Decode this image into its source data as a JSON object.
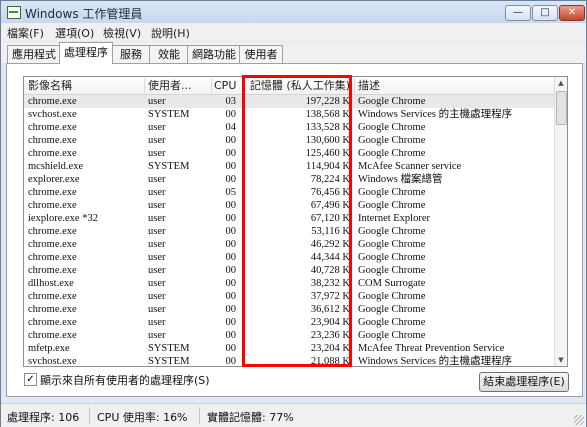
{
  "window": {
    "title": "Windows 工作管理員",
    "min": "—",
    "max": "□",
    "close": "✕"
  },
  "menu": [
    "檔案(F)",
    "選項(O)",
    "檢視(V)",
    "說明(H)"
  ],
  "tabs": [
    "應用程式",
    "處理程序",
    "服務",
    "效能",
    "網路功能",
    "使用者"
  ],
  "active_tab": "處理程序",
  "columns": {
    "name": "影像名稱",
    "user": "使用者...",
    "cpu": "CPU",
    "mem": "記憶體 (私人工作集)",
    "desc": "描述"
  },
  "rows": [
    {
      "name": "chrome.exe",
      "user": "user",
      "cpu": "03",
      "mem": "197,228 K",
      "desc": "Google Chrome"
    },
    {
      "name": "svchost.exe",
      "user": "SYSTEM",
      "cpu": "00",
      "mem": "138,568 K",
      "desc": "Windows Services 的主機處理程序"
    },
    {
      "name": "chrome.exe",
      "user": "user",
      "cpu": "04",
      "mem": "133,528 K",
      "desc": "Google Chrome"
    },
    {
      "name": "chrome.exe",
      "user": "user",
      "cpu": "00",
      "mem": "130,600 K",
      "desc": "Google Chrome"
    },
    {
      "name": "chrome.exe",
      "user": "user",
      "cpu": "00",
      "mem": "125,460 K",
      "desc": "Google Chrome"
    },
    {
      "name": "mcshield.exe",
      "user": "SYSTEM",
      "cpu": "00",
      "mem": "114,904 K",
      "desc": "McAfee Scanner service"
    },
    {
      "name": "explorer.exe",
      "user": "user",
      "cpu": "00",
      "mem": "78,224 K",
      "desc": "Windows 檔案總管"
    },
    {
      "name": "chrome.exe",
      "user": "user",
      "cpu": "05",
      "mem": "76,456 K",
      "desc": "Google Chrome"
    },
    {
      "name": "chrome.exe",
      "user": "user",
      "cpu": "00",
      "mem": "67,496 K",
      "desc": "Google Chrome"
    },
    {
      "name": "iexplore.exe *32",
      "user": "user",
      "cpu": "00",
      "mem": "67,120 K",
      "desc": "Internet Explorer"
    },
    {
      "name": "chrome.exe",
      "user": "user",
      "cpu": "00",
      "mem": "53,116 K",
      "desc": "Google Chrome"
    },
    {
      "name": "chrome.exe",
      "user": "user",
      "cpu": "00",
      "mem": "46,292 K",
      "desc": "Google Chrome"
    },
    {
      "name": "chrome.exe",
      "user": "user",
      "cpu": "00",
      "mem": "44,344 K",
      "desc": "Google Chrome"
    },
    {
      "name": "chrome.exe",
      "user": "user",
      "cpu": "00",
      "mem": "40,728 K",
      "desc": "Google Chrome"
    },
    {
      "name": "dllhost.exe",
      "user": "user",
      "cpu": "00",
      "mem": "38,232 K",
      "desc": "COM Surrogate"
    },
    {
      "name": "chrome.exe",
      "user": "user",
      "cpu": "00",
      "mem": "37,972 K",
      "desc": "Google Chrome"
    },
    {
      "name": "chrome.exe",
      "user": "user",
      "cpu": "00",
      "mem": "36,612 K",
      "desc": "Google Chrome"
    },
    {
      "name": "chrome.exe",
      "user": "user",
      "cpu": "00",
      "mem": "23,904 K",
      "desc": "Google Chrome"
    },
    {
      "name": "chrome.exe",
      "user": "user",
      "cpu": "00",
      "mem": "23,236 K",
      "desc": "Google Chrome"
    },
    {
      "name": "mfetp.exe",
      "user": "SYSTEM",
      "cpu": "00",
      "mem": "23,204 K",
      "desc": "McAfee Threat Prevention Service"
    },
    {
      "name": "svchost.exe",
      "user": "SYSTEM",
      "cpu": "00",
      "mem": "21,088 K",
      "desc": "Windows Services 的主機處理程序"
    }
  ],
  "show_all_checked": "✓",
  "show_all_label": "顯示來自所有使用者的處理程序(S)",
  "end_process": "結束處理程序(E)",
  "status": {
    "processes": "處理程序: 106",
    "cpu": "CPU 使用率: 16%",
    "memory": "實體記憶體: 77%"
  },
  "colors": {
    "highlight_box": "#ff0000"
  }
}
